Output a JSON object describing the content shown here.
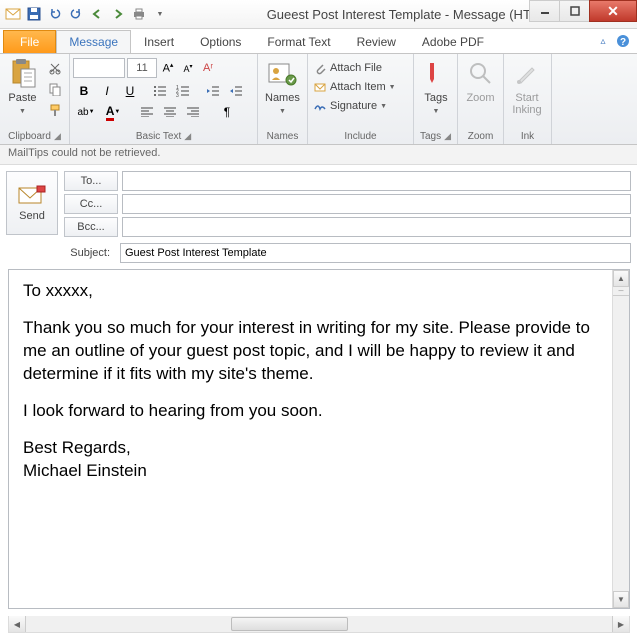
{
  "window": {
    "title": "Gueest Post Interest Template - Message (HT..."
  },
  "tabs": {
    "file": "File",
    "items": [
      "Message",
      "Insert",
      "Options",
      "Format Text",
      "Review",
      "Adobe PDF"
    ],
    "active_index": 0
  },
  "ribbon": {
    "clipboard": {
      "label": "Clipboard",
      "paste": "Paste"
    },
    "basic_text": {
      "label": "Basic Text",
      "font_size": "11"
    },
    "names": {
      "label": "Names",
      "names_btn": "Names"
    },
    "include": {
      "label": "Include",
      "attach_file": "Attach File",
      "attach_item": "Attach Item",
      "signature": "Signature"
    },
    "tags": {
      "label": "Tags",
      "tags_btn": "Tags"
    },
    "zoom": {
      "label": "Zoom",
      "zoom_btn": "Zoom"
    },
    "ink": {
      "label": "Ink",
      "start_inking": "Start\nInking"
    }
  },
  "mailtips": "MailTips could not be retrieved.",
  "header": {
    "send": "Send",
    "to": "To...",
    "cc": "Cc...",
    "bcc": "Bcc...",
    "subject_label": "Subject:",
    "to_value": "",
    "cc_value": "",
    "bcc_value": "",
    "subject_value": "Guest Post Interest Template"
  },
  "body": {
    "greeting": "To xxxxx,",
    "p1": "Thank you so much for your interest in writing for my site. Please provide to me an outline of your guest post topic, and I will be happy to review it and determine if it fits with my site's theme.",
    "p2": "I look forward to hearing from you soon.",
    "closing": "Best Regards,",
    "signature": "Michael Einstein"
  }
}
